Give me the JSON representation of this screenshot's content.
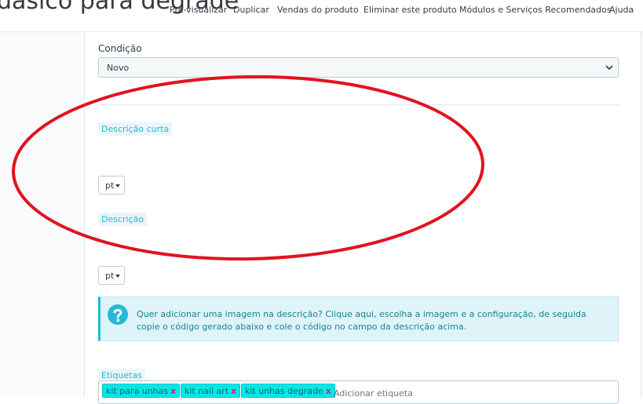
{
  "header": {
    "title": "dásico para degradê",
    "toolbar": [
      {
        "label": "Pré-visualizar"
      },
      {
        "label": "Duplicar"
      },
      {
        "label": "Vendas do produto"
      },
      {
        "label": "Eliminar este produto"
      },
      {
        "label": "Módulos e Serviços Recomendados"
      },
      {
        "label": "Ajuda"
      }
    ]
  },
  "form": {
    "condition": {
      "label": "Condição",
      "value": "Novo"
    },
    "short_description": {
      "label": "Descrição curta",
      "lang": "pt"
    },
    "description": {
      "label": "Descrição",
      "lang": "pt"
    },
    "image_help": {
      "text": "Quer adicionar uma imagem na descrição? Clique aqui, escolha a imagem e a configuração, de seguida copie o código gerado abaixo e cole o código no campo da descrição acima."
    },
    "tags": {
      "label": "Etiquetas",
      "items": [
        {
          "text": "kit para unhas",
          "remove": "x"
        },
        {
          "text": "kit nail art",
          "remove": "x"
        },
        {
          "text": "kit unhas degrade",
          "remove": "x"
        }
      ],
      "placeholder": "Adicionar etiqueta"
    }
  },
  "colors": {
    "accent": "#25b9d7",
    "annotation": "#e0141e",
    "tag_bg": "#00e8e8"
  },
  "icons": {
    "help": "question-circle-icon",
    "chevron": "chevron-down-icon",
    "caret": "caret-down-icon"
  }
}
